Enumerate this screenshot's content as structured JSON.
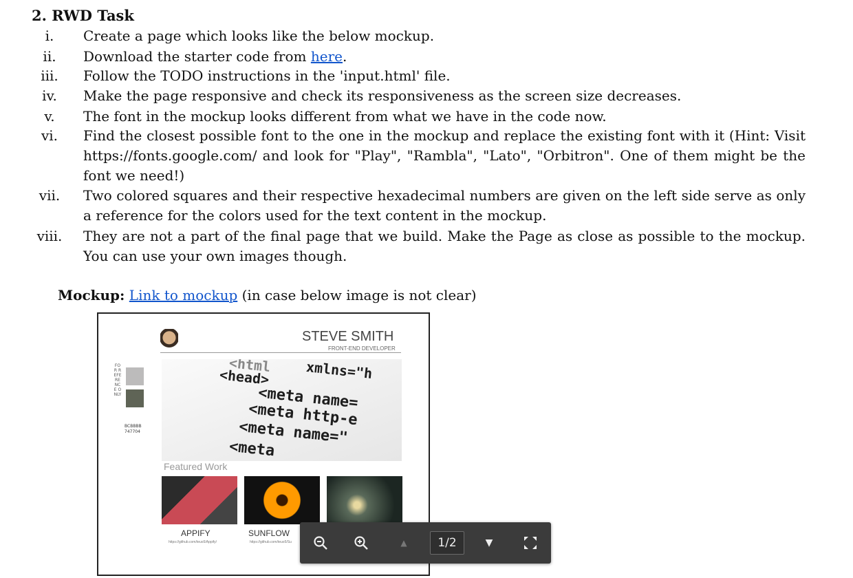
{
  "heading": "2. RWD Task",
  "items": [
    {
      "num": "i.",
      "lines": [
        "Create a page which looks like the below mockup."
      ]
    },
    {
      "num": "ii.",
      "prefix": "Download the starter code from ",
      "link": "here",
      "suffix": "."
    },
    {
      "num": "iii.",
      "lines": [
        "Follow the TODO instructions in the 'input.html' file."
      ]
    },
    {
      "num": "iv.",
      "lines": [
        "Make the page responsive and check its responsiveness as the screen size decreases."
      ]
    },
    {
      "num": "v.",
      "lines": [
        "The font in the mockup looks different from what we have in the code now."
      ]
    },
    {
      "num": "vi.",
      "lines": [
        "Find the closest possible font to the one in the mockup and replace the existing font with it (Hint: Visit https://fonts.google.com/ and look for \"Play\", \"Rambla\", \"Lato\", \"Orbitron\". One of them might be the font we need!)"
      ]
    },
    {
      "num": "vii.",
      "lines": [
        "Two colored squares and their respective hexadecimal numbers are given on the left side serve as only a reference for the colors used for the text content in the mockup."
      ]
    },
    {
      "num": "viii.",
      "lines": [
        "They are not a part of the final page that we build. Make the Page as close as possible to the mockup. You can use your own images though."
      ]
    }
  ],
  "mockup": {
    "label": "Mockup:",
    "link": "Link to mockup",
    "note": " (in case below image is not clear)"
  },
  "mockup_image": {
    "reference_text": "FOR REFERENCE ONLY",
    "hex1": "BCBBBB",
    "hex2": "747704",
    "name": "STEVE SMITH",
    "role": "FRONT-END DEVELOPER",
    "code_lines": [
      "<html",
      "xmlns=\"h",
      "<head>",
      "<meta name=",
      "<meta http-e",
      "<meta name=\"",
      "<meta"
    ],
    "featured": "Featured Work",
    "projects": [
      {
        "title": "APPIFY",
        "url": "https://github.com/teuo5/Appify/"
      },
      {
        "title": "SUNFLOW",
        "url": "https://github.com/teuo5/Su"
      },
      {
        "title": "",
        "url": ""
      }
    ],
    "colors": {
      "light": "#BCBBBB",
      "dark": "#747704"
    }
  },
  "toolbar": {
    "zoom_out_icon": "zoom-out-icon",
    "zoom_in_icon": "zoom-in-icon",
    "page": "1/2",
    "fit_icon": "fullscreen-icon"
  }
}
